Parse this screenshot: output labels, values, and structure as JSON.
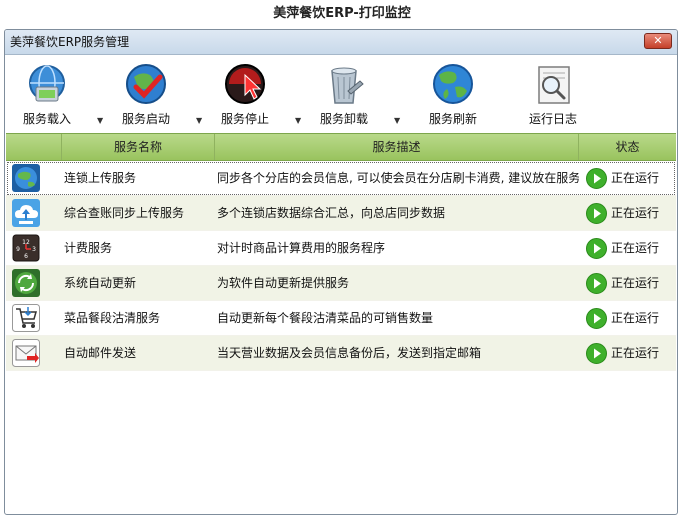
{
  "app": {
    "title": "美萍餐饮ERP-打印监控"
  },
  "window": {
    "title": "美萍餐饮ERP服务管理",
    "close_label": "✕"
  },
  "toolbar": {
    "items": [
      {
        "label": "服务载入",
        "icon": "service-load-icon",
        "dropdown": true
      },
      {
        "label": "服务启动",
        "icon": "service-start-icon",
        "dropdown": true
      },
      {
        "label": "服务停止",
        "icon": "service-stop-icon",
        "dropdown": true
      },
      {
        "label": "服务卸载",
        "icon": "service-uninstall-icon",
        "dropdown": true
      },
      {
        "label": "服务刷新",
        "icon": "service-refresh-icon",
        "dropdown": false
      },
      {
        "label": "运行日志",
        "icon": "run-log-icon",
        "dropdown": false
      }
    ]
  },
  "table": {
    "columns": [
      "服务名称",
      "服务描述",
      "状态"
    ],
    "rows": [
      {
        "icon": "globe-upload-icon",
        "name": "连锁上传服务",
        "desc": "同步各个分店的会员信息, 可以使会员在分店刷卡消费, 建议放在服务",
        "status": "正在运行"
      },
      {
        "icon": "cloud-upload-icon",
        "name": "综合查账同步上传服务",
        "desc": "多个连锁店数据综合汇总，向总店同步数据",
        "status": "正在运行"
      },
      {
        "icon": "clock-billing-icon",
        "name": "计费服务",
        "desc": "对计时商品计算费用的服务程序",
        "status": "正在运行"
      },
      {
        "icon": "auto-update-icon",
        "name": "系统自动更新",
        "desc": "为软件自动更新提供服务",
        "status": "正在运行"
      },
      {
        "icon": "shopping-cart-icon",
        "name": "菜品餐段沽清服务",
        "desc": "自动更新每个餐段沽清菜品的可销售数量",
        "status": "正在运行"
      },
      {
        "icon": "email-icon",
        "name": "自动邮件发送",
        "desc": "当天营业数据及会员信息备份后，发送到指定邮箱",
        "status": "正在运行"
      }
    ]
  },
  "colors": {
    "header_green": "#99c35e",
    "running_green": "#3fb02c",
    "alt_row": "#f1f3e6"
  }
}
